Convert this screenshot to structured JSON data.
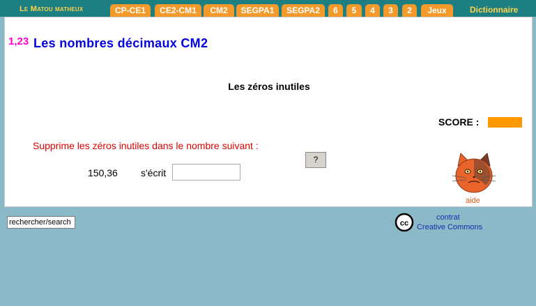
{
  "nav": {
    "brand": "Le Matou matheux",
    "tabs": [
      "CP-CE1",
      "CE2-CM1",
      "CM2",
      "SEGPA1",
      "SEGPA2",
      "6",
      "5",
      "4",
      "3",
      "2",
      "Jeux"
    ],
    "dictionary": "Dictionnaire"
  },
  "header": {
    "logo": "1,23",
    "title": "Les nombres décimaux CM2"
  },
  "exercise": {
    "subtitle": "Les zéros inutiles",
    "score_label": "SCORE :",
    "instruction": "Supprime les zéros inutiles dans le nombre suivant :",
    "number": "150,36",
    "writes_as": "s'écrit",
    "answer_value": "",
    "hint_button": "?",
    "help_label": "aide"
  },
  "footer": {
    "search_value": "rechercher/search",
    "cc_icon": "cc",
    "license_line1": "contrat",
    "license_line2": "Creative Commons"
  },
  "colors": {
    "nav_bg": "#1e7f82",
    "tab_bg": "#f39a2b",
    "brand": "#ffd24a",
    "title": "#0000dd",
    "instruction": "#e00000",
    "score": "#ff9900",
    "page_bg": "#8bb9c8"
  }
}
